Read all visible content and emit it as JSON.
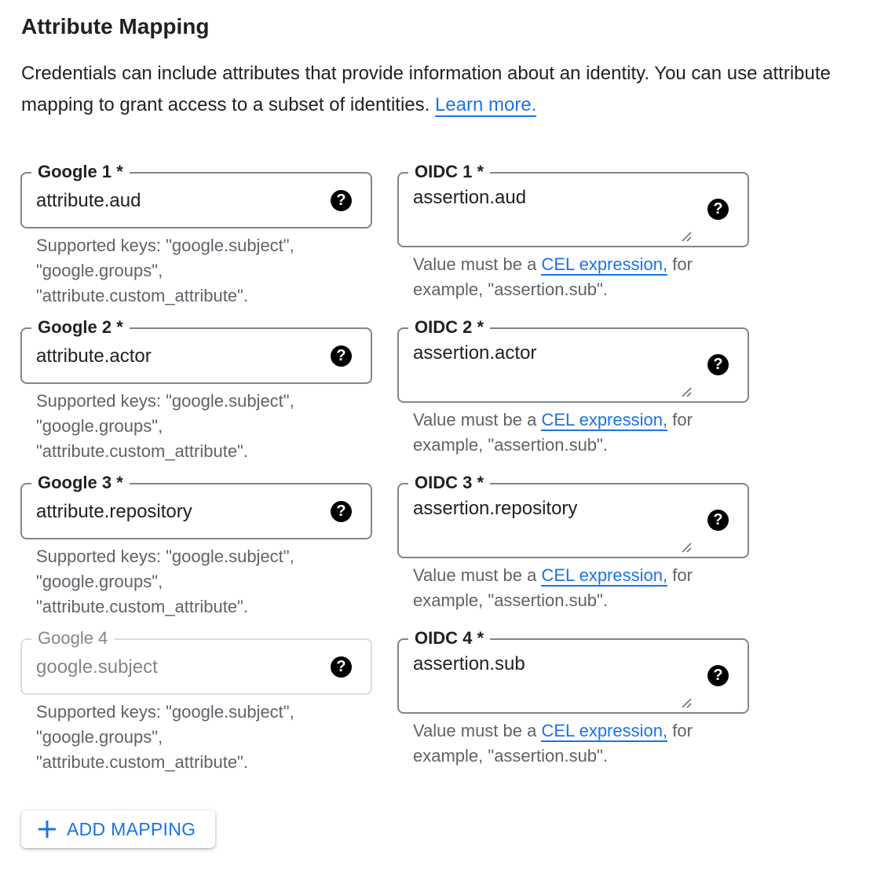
{
  "section": {
    "title": "Attribute Mapping",
    "description": "Credentials can include attributes that provide information about an identity. You can use attribute mapping to grant access to a subset of identities.",
    "learn_more": "Learn more."
  },
  "google_fields": [
    {
      "label": "Google 1 *",
      "value": "attribute.aud"
    },
    {
      "label": "Google 2 *",
      "value": "attribute.actor"
    },
    {
      "label": "Google 3 *",
      "value": "attribute.repository"
    },
    {
      "label": "Google 4",
      "value": "",
      "placeholder": "google.subject",
      "disabled": true
    }
  ],
  "google_hint": {
    "line1": "Supported keys: \"google.subject\",",
    "line2": "\"google.groups\",",
    "line3": "\"attribute.custom_attribute\"."
  },
  "oidc_fields": [
    {
      "label": "OIDC 1 *",
      "value": "assertion.aud"
    },
    {
      "label": "OIDC 2 *",
      "value": "assertion.actor"
    },
    {
      "label": "OIDC 3 *",
      "value": "assertion.repository"
    },
    {
      "label": "OIDC 4 *",
      "value": "assertion.sub"
    }
  ],
  "oidc_hint": {
    "prefix": "Value must be a",
    "link": "CEL expression,",
    "suffix": "for",
    "line2": "example, \"assertion.sub\"."
  },
  "help_icon_glyph": "?",
  "add_button": {
    "label": "ADD MAPPING",
    "icon": "plus-icon"
  },
  "colors": {
    "accent": "#1a73e8",
    "text": "#202124",
    "hint": "#5f6368",
    "border": "#80868b",
    "disabled_border": "#dadce0"
  }
}
